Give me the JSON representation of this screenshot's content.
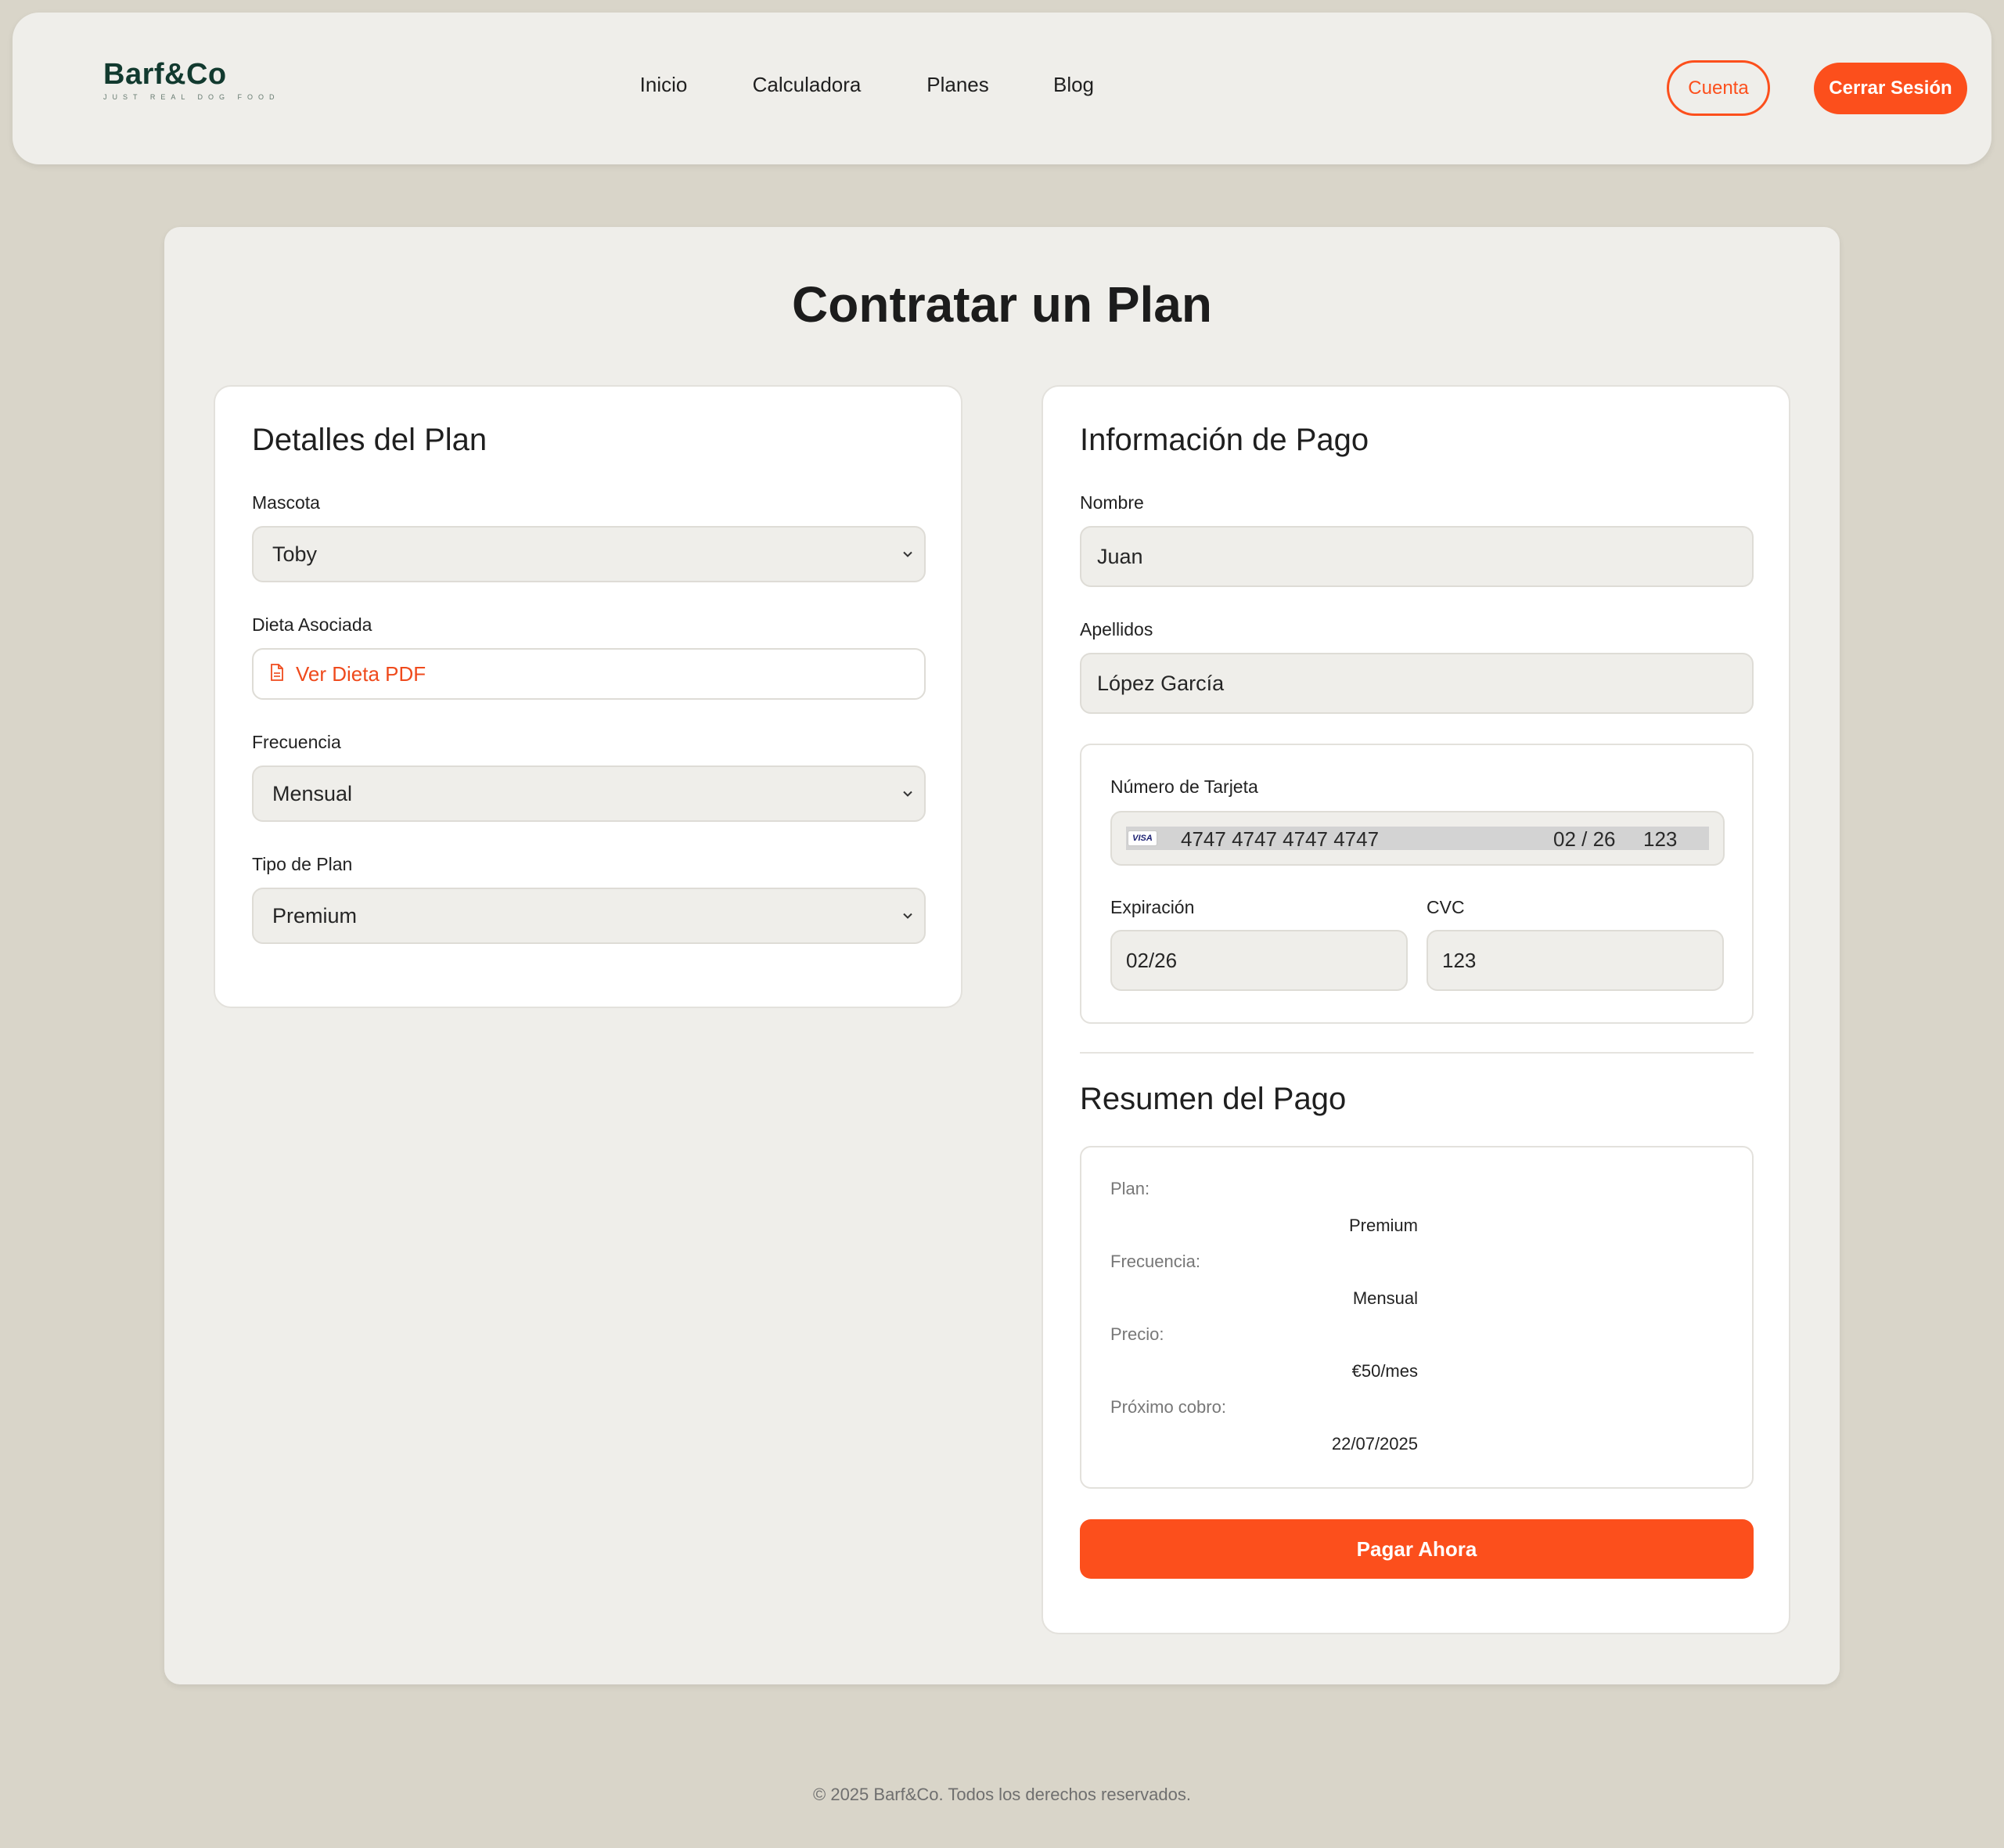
{
  "header": {
    "logo": "Barf&Co",
    "tagline": "JUST REAL DOG FOOD",
    "nav": [
      "Inicio",
      "Calculadora",
      "Planes",
      "Blog"
    ],
    "account_label": "Cuenta",
    "logout_label": "Cerrar Sesión"
  },
  "page": {
    "title": "Contratar un Plan"
  },
  "plan_details": {
    "title": "Detalles del Plan",
    "pet_label": "Mascota",
    "pet_value": "Toby",
    "diet_label": "Dieta Asociada",
    "diet_link": "Ver Dieta PDF",
    "frequency_label": "Frecuencia",
    "frequency_value": "Mensual",
    "plan_type_label": "Tipo de Plan",
    "plan_type_value": "Premium"
  },
  "payment": {
    "title": "Información de Pago",
    "first_name_label": "Nombre",
    "first_name_value": "Juan",
    "last_name_label": "Apellidos",
    "last_name_value": "López García",
    "card_number_label": "Número de Tarjeta",
    "card_brand": "VISA",
    "card_number_value": "4747 4747 4747 4747",
    "card_exp_inline": "02 / 26",
    "card_cvc_inline": "123",
    "expiration_label": "Expiración",
    "expiration_value": "02/26",
    "cvc_label": "CVC",
    "cvc_value": "123"
  },
  "summary": {
    "title": "Resumen del Pago",
    "rows": [
      {
        "label": "Plan:",
        "value": "Premium"
      },
      {
        "label": "Frecuencia:",
        "value": "Mensual"
      },
      {
        "label": "Precio:",
        "value": "€50/mes"
      },
      {
        "label": "Próximo cobro:",
        "value": "22/07/2025"
      }
    ],
    "pay_button": "Pagar Ahora"
  },
  "footer": {
    "text": "© 2025 Barf&Co. Todos los derechos reservados."
  },
  "colors": {
    "accent": "#fc4f1c",
    "logo": "#123a2f",
    "background": "#d9d5c9",
    "panel": "#efeeea"
  }
}
